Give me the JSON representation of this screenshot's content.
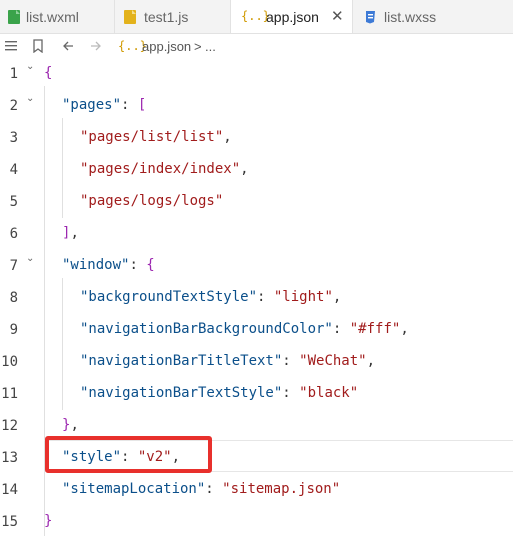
{
  "tabs": [
    {
      "label": "list.wxml",
      "icon": "wxml-file-icon",
      "active": false
    },
    {
      "label": "test1.js",
      "icon": "js-file-icon",
      "active": false
    },
    {
      "label": "app.json",
      "icon": "json-file-icon",
      "active": true
    },
    {
      "label": "list.wxss",
      "icon": "css-file-icon",
      "active": false
    }
  ],
  "breadcrumb": {
    "file_icon": "{..}",
    "file": "app.json",
    "sep": ">",
    "more": "..."
  },
  "code_lines": [
    {
      "n": "1",
      "tokens": [
        {
          "t": "{",
          "c": "b"
        }
      ]
    },
    {
      "n": "2",
      "tokens": [
        {
          "t": "\"pages\"",
          "c": "k"
        },
        {
          "t": ": ",
          "c": "p"
        },
        {
          "t": "[",
          "c": "b"
        }
      ]
    },
    {
      "n": "3",
      "tokens": [
        {
          "t": "\"pages/list/list\"",
          "c": "s"
        },
        {
          "t": ",",
          "c": "p"
        }
      ]
    },
    {
      "n": "4",
      "tokens": [
        {
          "t": "\"pages/index/index\"",
          "c": "s"
        },
        {
          "t": ",",
          "c": "p"
        }
      ]
    },
    {
      "n": "5",
      "tokens": [
        {
          "t": "\"pages/logs/logs\"",
          "c": "s"
        }
      ]
    },
    {
      "n": "6",
      "tokens": [
        {
          "t": "]",
          "c": "b"
        },
        {
          "t": ",",
          "c": "p"
        }
      ]
    },
    {
      "n": "7",
      "tokens": [
        {
          "t": "\"window\"",
          "c": "k"
        },
        {
          "t": ": ",
          "c": "p"
        },
        {
          "t": "{",
          "c": "b"
        }
      ]
    },
    {
      "n": "8",
      "tokens": [
        {
          "t": "\"backgroundTextStyle\"",
          "c": "k"
        },
        {
          "t": ": ",
          "c": "p"
        },
        {
          "t": "\"light\"",
          "c": "s"
        },
        {
          "t": ",",
          "c": "p"
        }
      ]
    },
    {
      "n": "9",
      "tokens": [
        {
          "t": "\"navigationBarBackgroundColor\"",
          "c": "k"
        },
        {
          "t": ": ",
          "c": "p"
        },
        {
          "t": "\"#fff\"",
          "c": "s"
        },
        {
          "t": ",",
          "c": "p"
        }
      ]
    },
    {
      "n": "10",
      "tokens": [
        {
          "t": "\"navigationBarTitleText\"",
          "c": "k"
        },
        {
          "t": ": ",
          "c": "p"
        },
        {
          "t": "\"WeChat\"",
          "c": "s"
        },
        {
          "t": ",",
          "c": "p"
        }
      ]
    },
    {
      "n": "11",
      "tokens": [
        {
          "t": "\"navigationBarTextStyle\"",
          "c": "k"
        },
        {
          "t": ": ",
          "c": "p"
        },
        {
          "t": "\"black\"",
          "c": "s"
        }
      ]
    },
    {
      "n": "12",
      "tokens": [
        {
          "t": "}",
          "c": "b"
        },
        {
          "t": ",",
          "c": "p"
        }
      ]
    },
    {
      "n": "13",
      "tokens": [
        {
          "t": "\"style\"",
          "c": "k"
        },
        {
          "t": ": ",
          "c": "p"
        },
        {
          "t": "\"v2\"",
          "c": "s"
        },
        {
          "t": ",",
          "c": "p"
        }
      ]
    },
    {
      "n": "14",
      "tokens": [
        {
          "t": "\"sitemapLocation\"",
          "c": "k"
        },
        {
          "t": ": ",
          "c": "p"
        },
        {
          "t": "\"sitemap.json\"",
          "c": "s"
        }
      ]
    },
    {
      "n": "15",
      "tokens": [
        {
          "t": "}",
          "c": "b"
        }
      ]
    }
  ],
  "highlighted_line": "13",
  "colors": {
    "key": "#0b4f8a",
    "string": "#a11c1c",
    "bracket": "#9c27b0",
    "highlight": "#e8302c"
  }
}
